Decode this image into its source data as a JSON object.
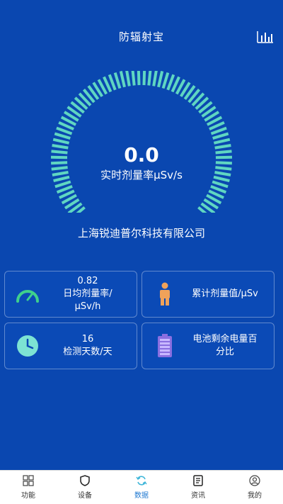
{
  "header": {
    "title": "防辐射宝"
  },
  "gauge": {
    "value": "0.0",
    "unit_label": "实时剂量率μSv/s",
    "fill_fraction": 1.0,
    "accent": "#5fd6c2"
  },
  "company": "上海锐迪普尔科技有限公司",
  "cards": {
    "avg": {
      "value": "0.82",
      "line1": "日均剂量率/",
      "line2": "μSv/h",
      "icon": "speedometer-icon"
    },
    "total": {
      "label": "累计剂量值/μSv",
      "icon": "person-icon"
    },
    "days": {
      "value": "16",
      "label": "检测天数/天",
      "icon": "clock-icon"
    },
    "battery": {
      "line1": "电池剩余电量百",
      "line2": "分比",
      "icon": "battery-icon"
    }
  },
  "tabs": [
    {
      "label": "功能",
      "icon": "grid-icon"
    },
    {
      "label": "设备",
      "icon": "shield-icon"
    },
    {
      "label": "数据",
      "icon": "sync-icon",
      "active": true
    },
    {
      "label": "资讯",
      "icon": "news-icon"
    },
    {
      "label": "我的",
      "icon": "user-icon"
    }
  ],
  "colors": {
    "background": "#0a47b0",
    "accent": "#1f78d1"
  }
}
